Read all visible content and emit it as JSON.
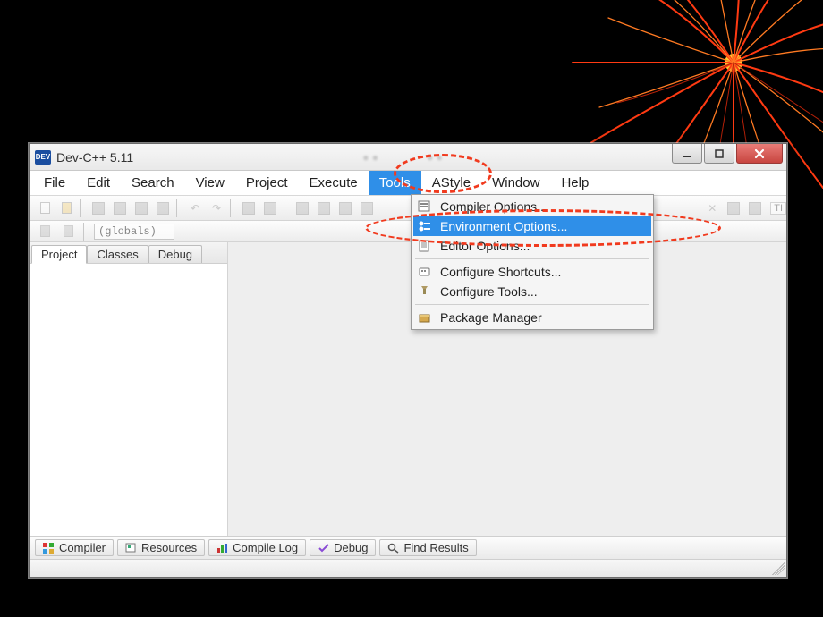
{
  "app": {
    "icon_text": "DEV",
    "title": "Dev-C++ 5.11"
  },
  "menubar": {
    "items": [
      "File",
      "Edit",
      "Search",
      "View",
      "Project",
      "Execute",
      "Tools",
      "AStyle",
      "Window",
      "Help"
    ],
    "open_index": 6
  },
  "toolbar2": {
    "globals_label": "(globals)"
  },
  "sidepanel": {
    "tabs": [
      "Project",
      "Classes",
      "Debug"
    ],
    "active_index": 0
  },
  "bottom_tabs": [
    {
      "label": "Compiler",
      "icon": "grid-icon"
    },
    {
      "label": "Resources",
      "icon": "resources-icon"
    },
    {
      "label": "Compile Log",
      "icon": "bars-icon"
    },
    {
      "label": "Debug",
      "icon": "check-icon"
    },
    {
      "label": "Find Results",
      "icon": "search-icon"
    }
  ],
  "tools_menu": {
    "items": [
      {
        "label": "Compiler Options...",
        "icon": "compiler-options-icon"
      },
      {
        "label": "Environment Options...",
        "icon": "environment-options-icon",
        "selected": true
      },
      {
        "label": "Editor Options...",
        "icon": "editor-options-icon"
      }
    ],
    "group2": [
      {
        "label": "Configure Shortcuts...",
        "icon": "shortcuts-icon"
      },
      {
        "label": "Configure Tools...",
        "icon": "tools-icon"
      }
    ],
    "group3": [
      {
        "label": "Package Manager",
        "icon": "package-manager-icon"
      }
    ]
  },
  "toolbar_end_label": "TI"
}
